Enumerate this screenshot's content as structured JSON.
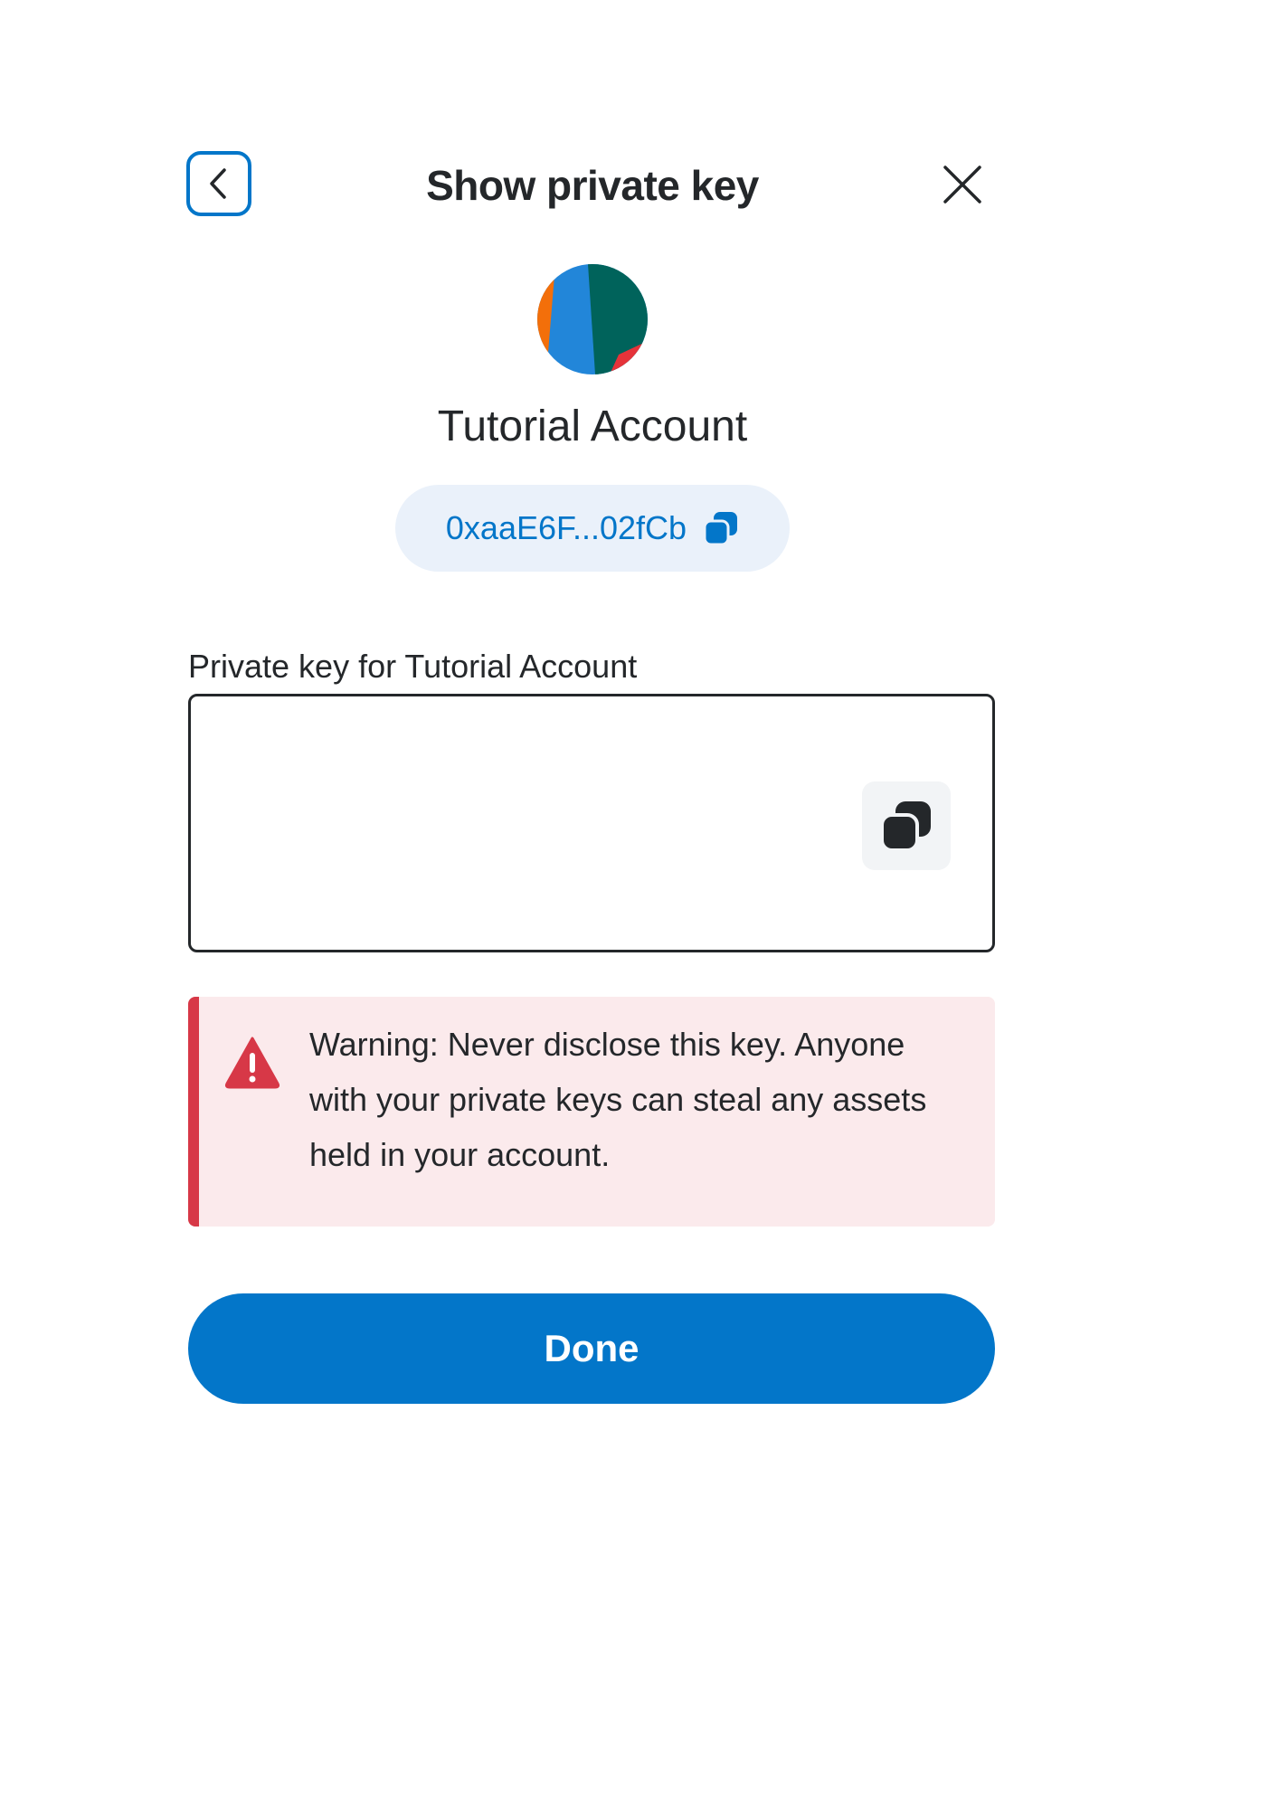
{
  "header": {
    "title": "Show private key",
    "back_icon": "chevron-left-icon",
    "close_icon": "close-icon"
  },
  "account": {
    "name": "Tutorial Account",
    "address": "0xaaE6F...02fCb",
    "copy_icon": "copy-icon"
  },
  "private_key": {
    "label": "Private key for Tutorial Account",
    "value": "",
    "copy_icon": "copy-icon"
  },
  "warning": {
    "icon": "warning-triangle-icon",
    "text": "Warning: Never disclose this key. Anyone with your private keys can steal any assets held in your account."
  },
  "actions": {
    "done_label": "Done"
  },
  "colors": {
    "primary": "#0376c9",
    "text": "#24272a",
    "error": "#d73847",
    "error_bg": "#fbeaec",
    "pill_bg": "#eaf1fa"
  }
}
